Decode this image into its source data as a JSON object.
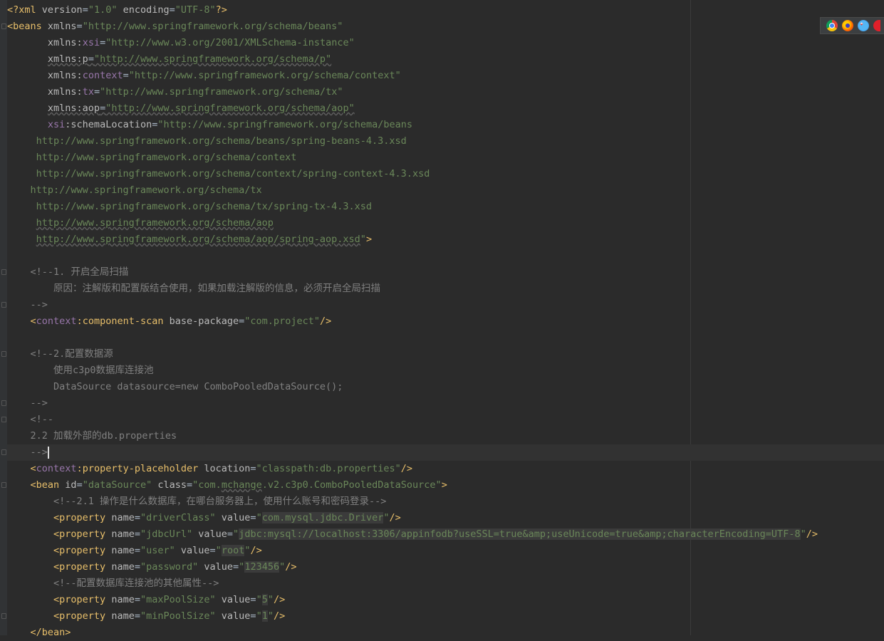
{
  "editor": {
    "file_type": "xml",
    "current_line_index": 27,
    "lines": [
      [
        {
          "c": "t",
          "x": "<?xml "
        },
        {
          "c": "a",
          "x": "version"
        },
        {
          "c": "pl",
          "x": "="
        },
        {
          "c": "v",
          "x": "\"1.0\""
        },
        {
          "c": "a",
          "x": " encoding"
        },
        {
          "c": "pl",
          "x": "="
        },
        {
          "c": "v",
          "x": "\"UTF-8\""
        },
        {
          "c": "t",
          "x": "?>"
        }
      ],
      [
        {
          "c": "t",
          "x": "<beans "
        },
        {
          "c": "a",
          "x": "xmlns"
        },
        {
          "c": "pl",
          "x": "="
        },
        {
          "c": "v",
          "x": "\"http://www.springframework.org/schema/beans\""
        }
      ],
      [
        {
          "c": "pl",
          "x": "       "
        },
        {
          "c": "a",
          "x": "xmlns:"
        },
        {
          "c": "ns",
          "x": "xsi"
        },
        {
          "c": "pl",
          "x": "="
        },
        {
          "c": "v",
          "x": "\"http://www.w3.org/2001/XMLSchema-instance\""
        }
      ],
      [
        {
          "c": "pl",
          "x": "       "
        },
        {
          "c": "a ul",
          "x": "xmlns:p"
        },
        {
          "c": "pl ul",
          "x": "="
        },
        {
          "c": "v ul",
          "x": "\"http://www.springframework.org/schema/p\""
        }
      ],
      [
        {
          "c": "pl",
          "x": "       "
        },
        {
          "c": "a",
          "x": "xmlns:"
        },
        {
          "c": "ns",
          "x": "context"
        },
        {
          "c": "pl",
          "x": "="
        },
        {
          "c": "v",
          "x": "\"http://www.springframework.org/schema/context\""
        }
      ],
      [
        {
          "c": "pl",
          "x": "       "
        },
        {
          "c": "a",
          "x": "xmlns:"
        },
        {
          "c": "ns",
          "x": "tx"
        },
        {
          "c": "pl",
          "x": "="
        },
        {
          "c": "v",
          "x": "\"http://www.springframework.org/schema/tx\""
        }
      ],
      [
        {
          "c": "pl",
          "x": "       "
        },
        {
          "c": "a ul",
          "x": "xmlns:aop"
        },
        {
          "c": "pl ul",
          "x": "="
        },
        {
          "c": "v ul",
          "x": "\"http://www.springframework.org/schema/aop\""
        }
      ],
      [
        {
          "c": "pl",
          "x": "       "
        },
        {
          "c": "ns",
          "x": "xsi"
        },
        {
          "c": "a",
          "x": ":schemaLocation"
        },
        {
          "c": "pl",
          "x": "="
        },
        {
          "c": "v",
          "x": "\"http://www.springframework.org/schema/beans"
        }
      ],
      [
        {
          "c": "v",
          "x": "     http://www.springframework.org/schema/beans/spring-beans-4.3.xsd"
        }
      ],
      [
        {
          "c": "v",
          "x": "     http://www.springframework.org/schema/context"
        }
      ],
      [
        {
          "c": "v",
          "x": "     http://www.springframework.org/schema/context/spring-context-4.3.xsd"
        }
      ],
      [
        {
          "c": "v",
          "x": "    http://www.springframework.org/schema/tx"
        }
      ],
      [
        {
          "c": "v",
          "x": "     http://www.springframework.org/schema/tx/spring-tx-4.3.xsd"
        }
      ],
      [
        {
          "c": "v",
          "x": "     "
        },
        {
          "c": "v ul",
          "x": "http://www.springframework.org/schema/aop"
        }
      ],
      [
        {
          "c": "v",
          "x": "     "
        },
        {
          "c": "v ul",
          "x": "http://www.springframework.org/schema/aop/spring-aop.xsd"
        },
        {
          "c": "v",
          "x": "\""
        },
        {
          "c": "t",
          "x": ">"
        }
      ],
      [],
      [
        {
          "c": "c",
          "x": "    <!--1. 开启全局扫描"
        }
      ],
      [
        {
          "c": "c",
          "x": "        原因：注解版和配置版结合使用，如果加载注解版的信息，必须开启全局扫描"
        }
      ],
      [
        {
          "c": "c",
          "x": "    -->"
        }
      ],
      [
        {
          "c": "pl",
          "x": "    "
        },
        {
          "c": "t",
          "x": "<"
        },
        {
          "c": "ns",
          "x": "context"
        },
        {
          "c": "t",
          "x": ":component-scan "
        },
        {
          "c": "a",
          "x": "base-package"
        },
        {
          "c": "pl",
          "x": "="
        },
        {
          "c": "v",
          "x": "\"com.project\""
        },
        {
          "c": "t",
          "x": "/>"
        }
      ],
      [],
      [
        {
          "c": "c",
          "x": "    <!--2.配置数据源"
        }
      ],
      [
        {
          "c": "c",
          "x": "        使用c3p0数据库连接池"
        }
      ],
      [
        {
          "c": "c",
          "x": "        DataSource datasource=new ComboPooledDataSource();"
        }
      ],
      [
        {
          "c": "c",
          "x": "    -->"
        }
      ],
      [
        {
          "c": "c",
          "x": "    <!--"
        }
      ],
      [
        {
          "c": "c",
          "x": "    2.2 加载外部的db.properties"
        }
      ],
      [
        {
          "c": "c",
          "x": "    -->"
        }
      ],
      [
        {
          "c": "pl",
          "x": "    "
        },
        {
          "c": "t",
          "x": "<"
        },
        {
          "c": "ns",
          "x": "context"
        },
        {
          "c": "t",
          "x": ":property-placeholder "
        },
        {
          "c": "a",
          "x": "location"
        },
        {
          "c": "pl",
          "x": "="
        },
        {
          "c": "v",
          "x": "\"classpath:db.properties\""
        },
        {
          "c": "t",
          "x": "/>"
        }
      ],
      [
        {
          "c": "pl",
          "x": "    "
        },
        {
          "c": "t",
          "x": "<bean "
        },
        {
          "c": "a",
          "x": "id"
        },
        {
          "c": "pl",
          "x": "="
        },
        {
          "c": "v",
          "x": "\"dataSource\""
        },
        {
          "c": "a",
          "x": " class"
        },
        {
          "c": "pl",
          "x": "="
        },
        {
          "c": "v",
          "x": "\"com."
        },
        {
          "c": "v ul",
          "x": "mchange"
        },
        {
          "c": "v",
          "x": ".v2.c3p0.ComboPooledDataSource\""
        },
        {
          "c": "t",
          "x": ">"
        }
      ],
      [
        {
          "c": "c",
          "x": "        <!--2.1 操作是什么数据库，在哪台服务器上，使用什么账号和密码登录-->"
        }
      ],
      [
        {
          "c": "pl",
          "x": "        "
        },
        {
          "c": "t",
          "x": "<property "
        },
        {
          "c": "a",
          "x": "name"
        },
        {
          "c": "pl",
          "x": "="
        },
        {
          "c": "v",
          "x": "\"driverClass\""
        },
        {
          "c": "a",
          "x": " value"
        },
        {
          "c": "pl",
          "x": "="
        },
        {
          "c": "v",
          "x": "\""
        },
        {
          "c": "v hl",
          "x": "com.mysql.jdbc.Driver"
        },
        {
          "c": "v",
          "x": "\""
        },
        {
          "c": "t",
          "x": "/>"
        }
      ],
      [
        {
          "c": "pl",
          "x": "        "
        },
        {
          "c": "t",
          "x": "<property "
        },
        {
          "c": "a",
          "x": "name"
        },
        {
          "c": "pl",
          "x": "="
        },
        {
          "c": "v",
          "x": "\"jdbcUrl\""
        },
        {
          "c": "a",
          "x": " value"
        },
        {
          "c": "pl",
          "x": "="
        },
        {
          "c": "v",
          "x": "\""
        },
        {
          "c": "v hl",
          "x": "jdbc:mysql://localhost:3306/appinfodb?useSSL=true&amp;useUnicode=true&amp;characterEncoding=UTF-8"
        },
        {
          "c": "v",
          "x": "\""
        },
        {
          "c": "t",
          "x": "/>"
        }
      ],
      [
        {
          "c": "pl",
          "x": "        "
        },
        {
          "c": "t",
          "x": "<property "
        },
        {
          "c": "a",
          "x": "name"
        },
        {
          "c": "pl",
          "x": "="
        },
        {
          "c": "v",
          "x": "\"user\""
        },
        {
          "c": "a",
          "x": " value"
        },
        {
          "c": "pl",
          "x": "="
        },
        {
          "c": "v",
          "x": "\""
        },
        {
          "c": "v hl",
          "x": "root"
        },
        {
          "c": "v",
          "x": "\""
        },
        {
          "c": "t",
          "x": "/>"
        }
      ],
      [
        {
          "c": "pl",
          "x": "        "
        },
        {
          "c": "t",
          "x": "<property "
        },
        {
          "c": "a",
          "x": "name"
        },
        {
          "c": "pl",
          "x": "="
        },
        {
          "c": "v",
          "x": "\"password\""
        },
        {
          "c": "a",
          "x": " value"
        },
        {
          "c": "pl",
          "x": "="
        },
        {
          "c": "v",
          "x": "\""
        },
        {
          "c": "v hl",
          "x": "123456"
        },
        {
          "c": "v",
          "x": "\""
        },
        {
          "c": "t",
          "x": "/>"
        }
      ],
      [
        {
          "c": "c",
          "x": "        <!--配置数据库连接池的其他属性-->"
        }
      ],
      [
        {
          "c": "pl",
          "x": "        "
        },
        {
          "c": "t",
          "x": "<property "
        },
        {
          "c": "a",
          "x": "name"
        },
        {
          "c": "pl",
          "x": "="
        },
        {
          "c": "v",
          "x": "\"maxPoolSize\""
        },
        {
          "c": "a",
          "x": " value"
        },
        {
          "c": "pl",
          "x": "="
        },
        {
          "c": "v",
          "x": "\""
        },
        {
          "c": "v hl",
          "x": "5"
        },
        {
          "c": "v",
          "x": "\""
        },
        {
          "c": "t",
          "x": "/>"
        }
      ],
      [
        {
          "c": "pl",
          "x": "        "
        },
        {
          "c": "t",
          "x": "<property "
        },
        {
          "c": "a",
          "x": "name"
        },
        {
          "c": "pl",
          "x": "="
        },
        {
          "c": "v",
          "x": "\"minPoolSize\""
        },
        {
          "c": "a",
          "x": " value"
        },
        {
          "c": "pl",
          "x": "="
        },
        {
          "c": "v",
          "x": "\""
        },
        {
          "c": "v hl",
          "x": "1"
        },
        {
          "c": "v",
          "x": "\""
        },
        {
          "c": "t",
          "x": "/>"
        }
      ],
      [
        {
          "c": "pl",
          "x": "    "
        },
        {
          "c": "t",
          "x": "</bean>"
        }
      ]
    ],
    "fold_markers": [
      1,
      16,
      18,
      21,
      24,
      25,
      27,
      29,
      37
    ]
  },
  "browser_bar": {
    "icons": [
      "chrome-icon",
      "firefox-icon",
      "safari-icon",
      "opera-icon"
    ]
  },
  "colors": {
    "background": "#2b2b2b",
    "tag": "#e8bf6a",
    "attribute": "#bababa",
    "value": "#6a8759",
    "namespace": "#9876aa",
    "comment": "#808080"
  }
}
